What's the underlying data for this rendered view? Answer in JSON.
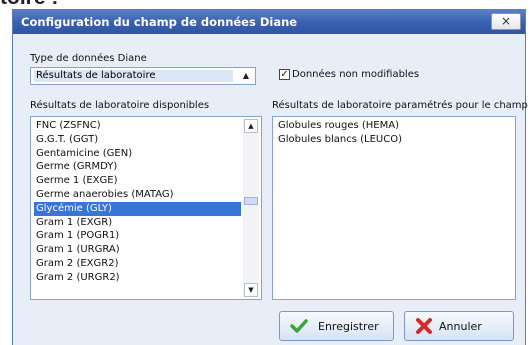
{
  "background": {
    "partial_text": "toire :"
  },
  "window": {
    "title": "Configuration du champ de données Diane",
    "close_label": "×"
  },
  "data_type": {
    "label": "Type de données Diane",
    "selected": "Résultats de laboratoire",
    "arrow": "▲"
  },
  "readonly": {
    "label": "Données non modifiables",
    "checked": true,
    "mark": "✓"
  },
  "available": {
    "header": "Résultats de laboratoire disponibles",
    "items": [
      "FNC (ZSFNC)",
      "G.G.T. (GGT)",
      "Gentamicine (GEN)",
      "Germe (GRMDY)",
      "Germe 1 (EXGE)",
      "Germe anaerobies (MATAG)",
      "Glycémie (GLY)",
      "Gram 1 (EXGR)",
      "Gram 1 (POGR1)",
      "Gram 1 (URGRA)",
      "Gram 2 (EXGR2)",
      "Gram 2 (URGR2)"
    ],
    "selected_index": 6,
    "scroll_up": "▲",
    "scroll_down": "▼"
  },
  "configured": {
    "header": "Résultats de laboratoire paramétrés pour le champ",
    "items": [
      "Globules rouges (HEMA)",
      "Globules blancs (LEUCO)"
    ]
  },
  "buttons": {
    "save": "Enregistrer",
    "cancel": "Annuler"
  },
  "colors": {
    "title_bar": "#3a62b0",
    "selection": "#3875d7",
    "save_icon": "#3aa63a",
    "cancel_icon": "#d42a2a"
  }
}
